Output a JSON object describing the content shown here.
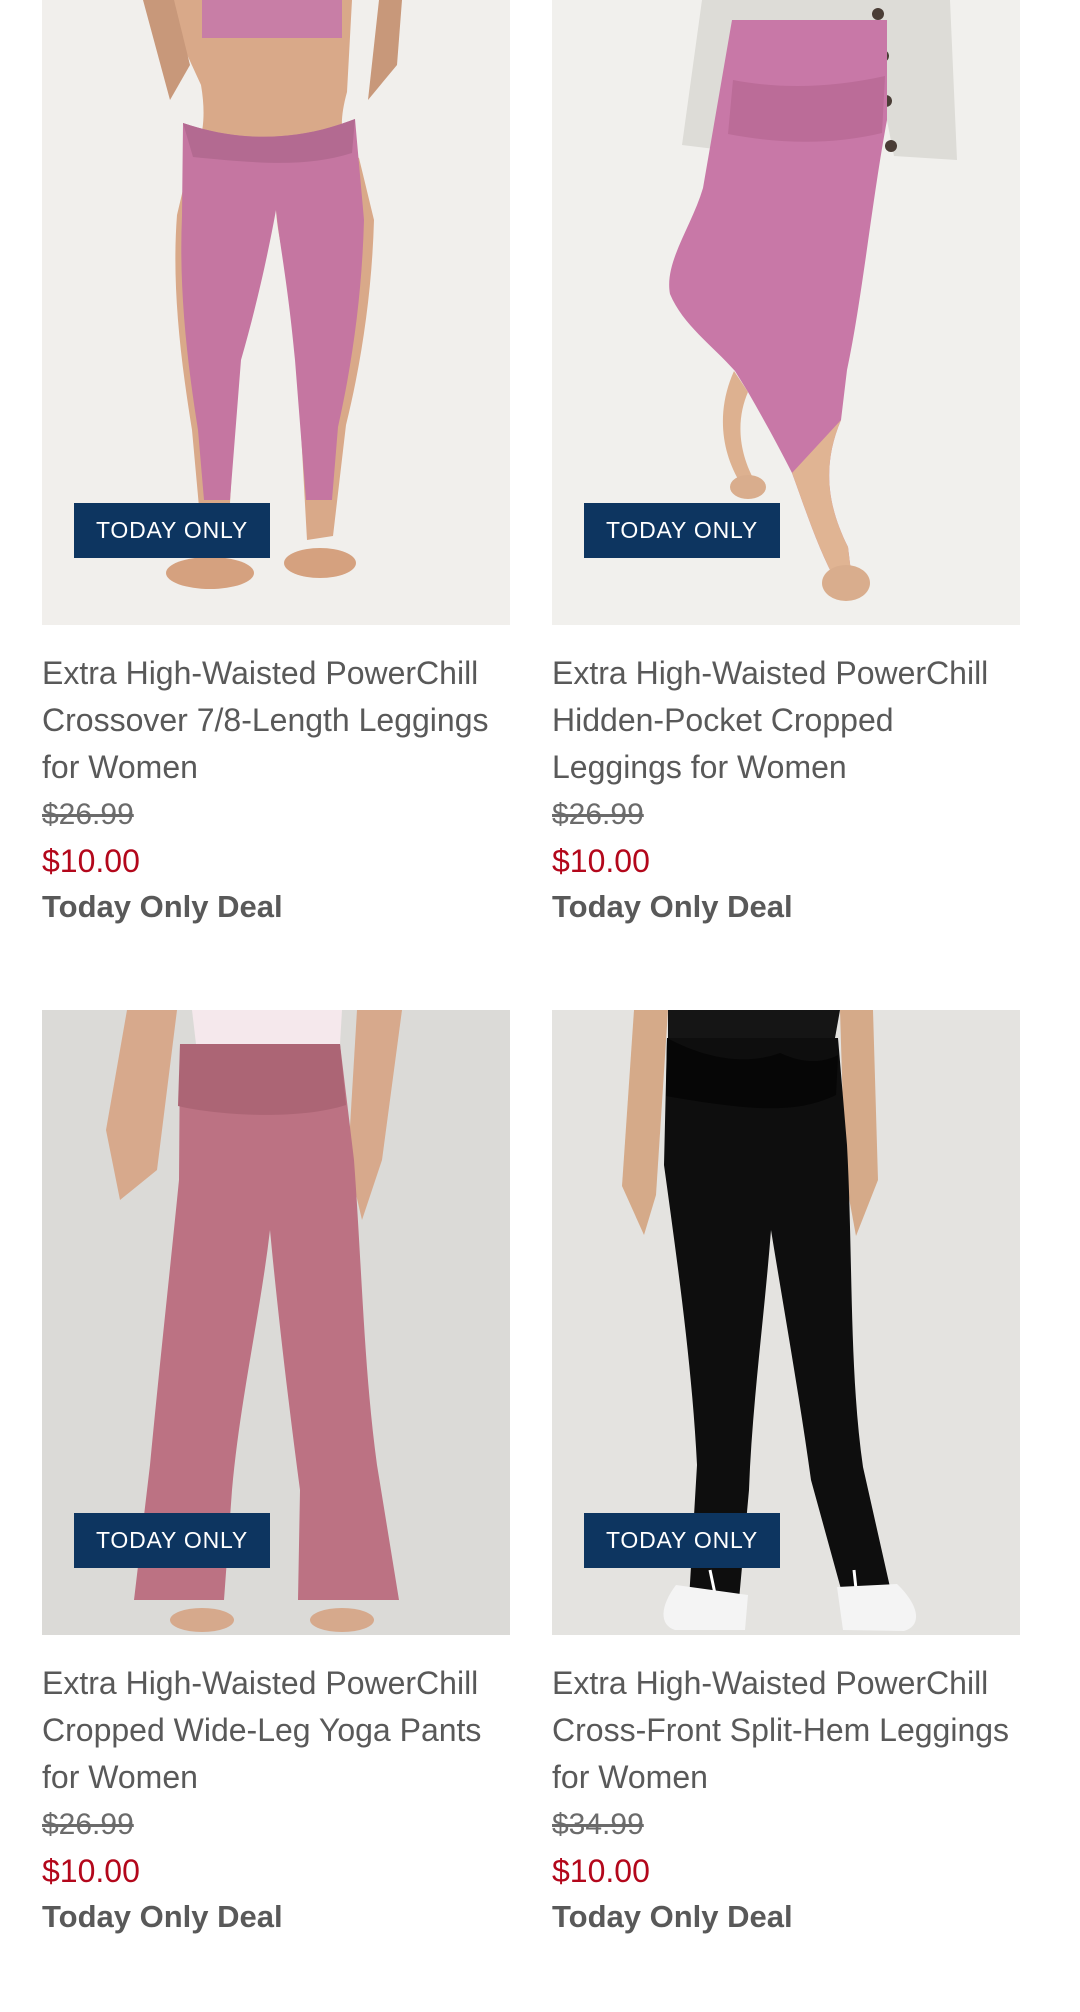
{
  "colors": {
    "badge_bg": "#0d3560",
    "sale_price": "#b3071b",
    "product_text": "#595959"
  },
  "products": [
    {
      "badge": "TODAY ONLY",
      "title": "Extra High-Waisted PowerChill Crossover 7/8-Length Leggings for Women",
      "original_price": "$26.99",
      "sale_price": "$10.00",
      "deal_text": "Today Only Deal"
    },
    {
      "badge": "TODAY ONLY",
      "title": "Extra High-Waisted PowerChill Hidden-Pocket Cropped Leggings for Women",
      "original_price": "$26.99",
      "sale_price": "$10.00",
      "deal_text": "Today Only Deal"
    },
    {
      "badge": "TODAY ONLY",
      "title": "Extra High-Waisted PowerChill Cropped Wide-Leg Yoga Pants for Women",
      "original_price": "$26.99",
      "sale_price": "$10.00",
      "deal_text": "Today Only Deal"
    },
    {
      "badge": "TODAY ONLY",
      "title": "Extra High-Waisted PowerChill Cross-Front Split-Hem Leggings for Women",
      "original_price": "$34.99",
      "sale_price": "$10.00",
      "deal_text": "Today Only Deal"
    }
  ]
}
